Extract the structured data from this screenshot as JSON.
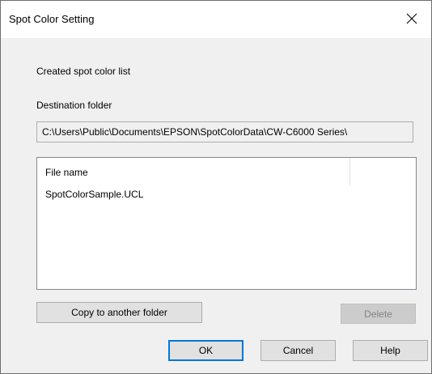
{
  "window": {
    "title": "Spot Color Setting",
    "close_icon": "close-icon"
  },
  "main": {
    "section_label": "Created spot color list",
    "destination_label": "Destination folder",
    "destination_path": "C:\\Users\\Public\\Documents\\EPSON\\SpotColorData\\CW-C6000 Series\\",
    "list": {
      "columns": [
        "File name"
      ],
      "rows": [
        "SpotColorSample.UCL"
      ]
    }
  },
  "buttons": {
    "copy_label": "Copy to another folder",
    "delete_label": "Delete",
    "ok_label": "OK",
    "cancel_label": "Cancel",
    "help_label": "Help"
  },
  "colors": {
    "dialog_bg": "#f0f0f0",
    "default_button_border": "#0078d7",
    "disabled_text": "#838383"
  }
}
